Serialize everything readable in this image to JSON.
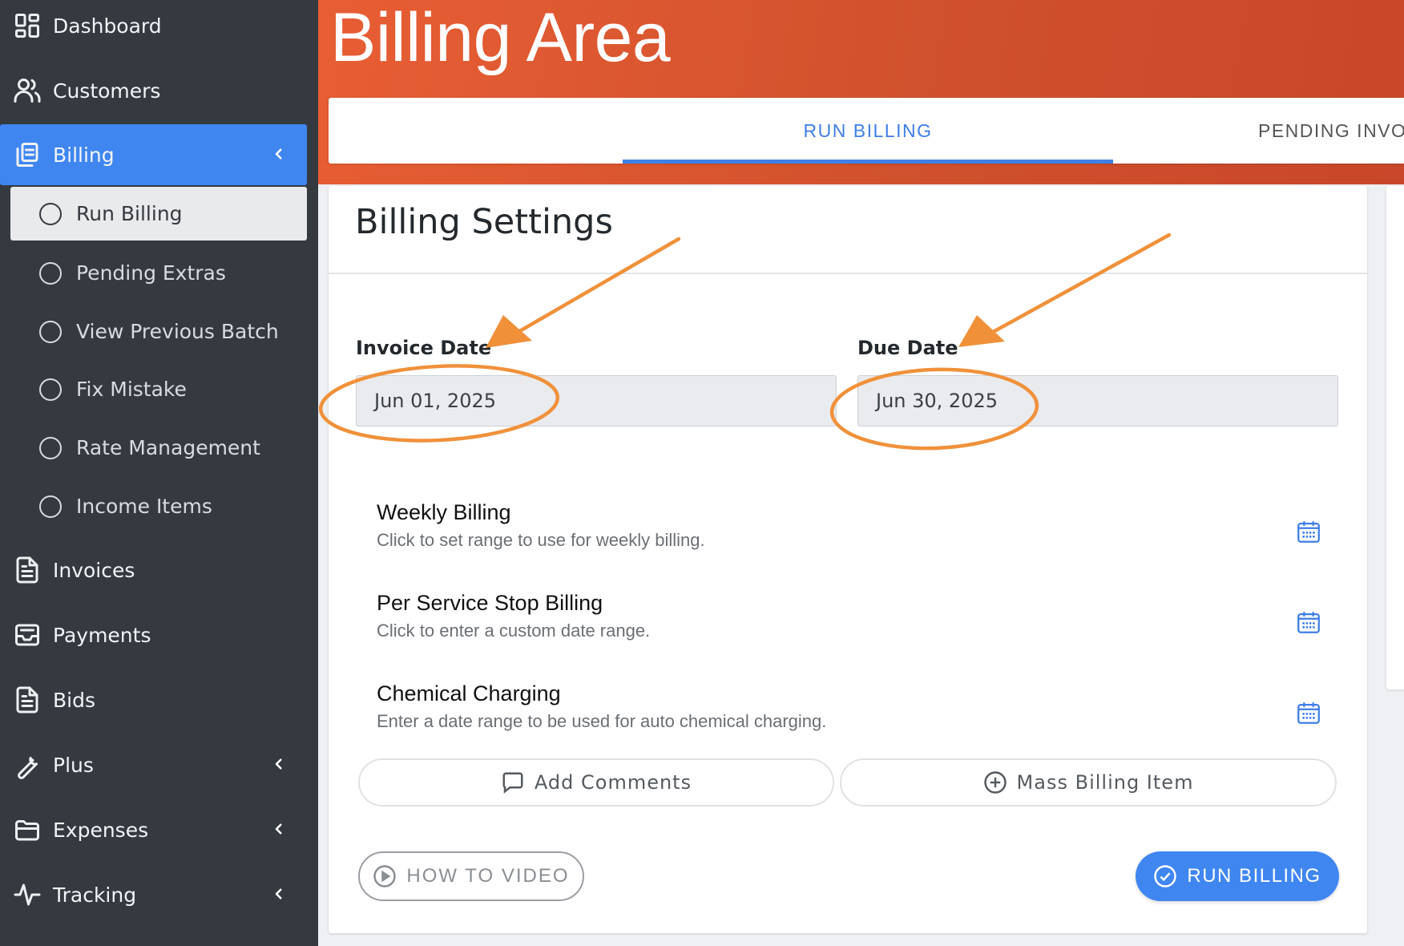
{
  "sidebar": {
    "items": [
      {
        "label": "Dashboard",
        "icon": "dashboard-icon"
      },
      {
        "label": "Customers",
        "icon": "users-icon"
      },
      {
        "label": "Billing",
        "icon": "copy-icon"
      },
      {
        "label": "Invoices",
        "icon": "document-icon"
      },
      {
        "label": "Payments",
        "icon": "inbox-icon"
      },
      {
        "label": "Bids",
        "icon": "document-icon"
      },
      {
        "label": "Plus",
        "icon": "wrench-icon"
      },
      {
        "label": "Expenses",
        "icon": "folder-icon"
      },
      {
        "label": "Tracking",
        "icon": "activity-icon"
      }
    ],
    "billing_subitems": [
      {
        "label": "Run Billing"
      },
      {
        "label": "Pending Extras"
      },
      {
        "label": "View Previous Batch"
      },
      {
        "label": "Fix Mistake"
      },
      {
        "label": "Rate Management"
      },
      {
        "label": "Income Items"
      }
    ]
  },
  "header": {
    "title": "Billing Area",
    "tabs": [
      {
        "label": "RUN BILLING"
      },
      {
        "label": "PENDING INVO"
      }
    ]
  },
  "card": {
    "title": "Billing Settings",
    "invoice_date": {
      "label": "Invoice Date",
      "value": "Jun 01, 2025"
    },
    "due_date": {
      "label": "Due Date",
      "value": "Jun 30, 2025"
    },
    "options": [
      {
        "title": "Weekly Billing",
        "desc": "Click to set range to use for weekly billing."
      },
      {
        "title": "Per Service Stop Billing",
        "desc": "Click to enter a custom date range."
      },
      {
        "title": "Chemical Charging",
        "desc": "Enter a date range to be used for auto chemical charging."
      }
    ],
    "add_comments": "Add Comments",
    "mass_billing": "Mass Billing Item",
    "how_to_video": "HOW TO VIDEO",
    "run_billing": "RUN BILLING"
  },
  "colors": {
    "sidebar_bg": "#343a40",
    "accent_blue": "#3f86f1",
    "header_orange": "#d9552f",
    "annotation_orange": "#f0913a"
  }
}
